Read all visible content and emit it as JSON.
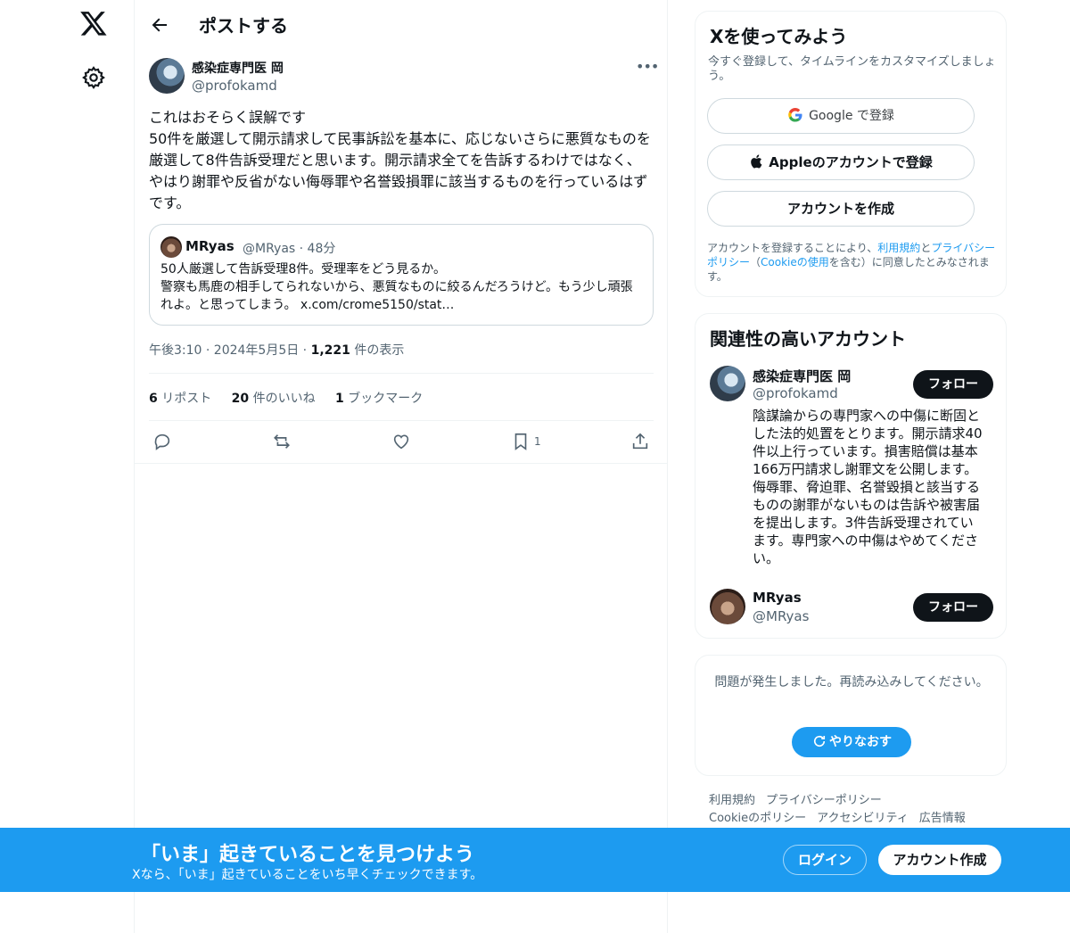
{
  "nav": {
    "logo_icon": "x-logo-icon",
    "settings_icon": "gear-icon"
  },
  "header": {
    "title": "ポストする"
  },
  "tweet": {
    "author_name": "感染症専門医 岡",
    "author_handle": "@profokamd",
    "text": "これはおそらく誤解です\n50件を厳選して開示請求して民事訴訟を基本に、応じないさらに悪質なものを厳選して8件告訴受理だと思います。開示請求全てを告訴するわけではなく、やはり謝罪や反省がない侮辱罪や名誉毀損罪に該当するものを行っているはずです。",
    "quote": {
      "name": "MRyas",
      "handle": "@MRyas · 48分",
      "text": "50人厳選して告訴受理8件。受理率をどう見るか。\n警察も馬鹿の相手してられないから、悪質なものに絞るんだろうけど。もう少し頑張れよ。と思ってしまう。 x.com/crome5150/stat…"
    },
    "time": "午後3:10 · 2024年5月5日 · ",
    "views": "1,221",
    "views_label": " 件の表示",
    "reposts_count": "6",
    "reposts_label": " リポスト",
    "likes_count": "20",
    "likes_label": " 件のいいね",
    "bookmarks_count": "1",
    "bookmarks_label": " ブックマーク",
    "bookmark_action_count": "1"
  },
  "signup": {
    "title": "Xを使ってみよう",
    "subtitle": "今すぐ登録して、タイムラインをカスタマイズしましょう。",
    "google_label": "Google で登録",
    "apple_label": "Appleのアカウントで登録",
    "create_label": "アカウントを作成",
    "legal_pre": "アカウントを登録することにより、",
    "legal_terms": "利用規約",
    "legal_and": "と",
    "legal_privacy": "プライバシーポリシー",
    "legal_mid": "（",
    "legal_cookie": "Cookieの使用",
    "legal_post": "を含む）に同意したとみなされます。"
  },
  "related": {
    "title": "関連性の高いアカウント",
    "accounts": [
      {
        "name": "感染症専門医 岡",
        "handle": "@profokamd",
        "follow_label": "フォロー",
        "bio": "陰謀論からの専門家への中傷に断固とした法的処置をとります。開示請求40件以上行っています。損害賠償は基本166万円請求し謝罪文を公開します。侮辱罪、脅迫罪、名誉毀損と該当するものの謝罪がないものは告訴や被害届を提出します。3件告訴受理されています。専門家への中傷はやめてください。"
      },
      {
        "name": "MRyas",
        "handle": "@MRyas",
        "follow_label": "フォロー"
      }
    ]
  },
  "error": {
    "text": "問題が発生しました。再読み込みしてください。",
    "retry_label": "やりなおす"
  },
  "footer": {
    "links": [
      "利用規約",
      "プライバシーポリシー",
      "Cookieのポリシー",
      "アクセシビリティ",
      "広告情報"
    ]
  },
  "banner": {
    "title": "「いま」起きていることを見つけよう",
    "subtitle": "Xなら、「いま」起きていることをいち早くチェックできます。",
    "login_label": "ログイン",
    "signup_label": "アカウント作成"
  },
  "colors": {
    "accent": "#1d9bf0",
    "text": "#0f1419",
    "secondary": "#536471"
  }
}
